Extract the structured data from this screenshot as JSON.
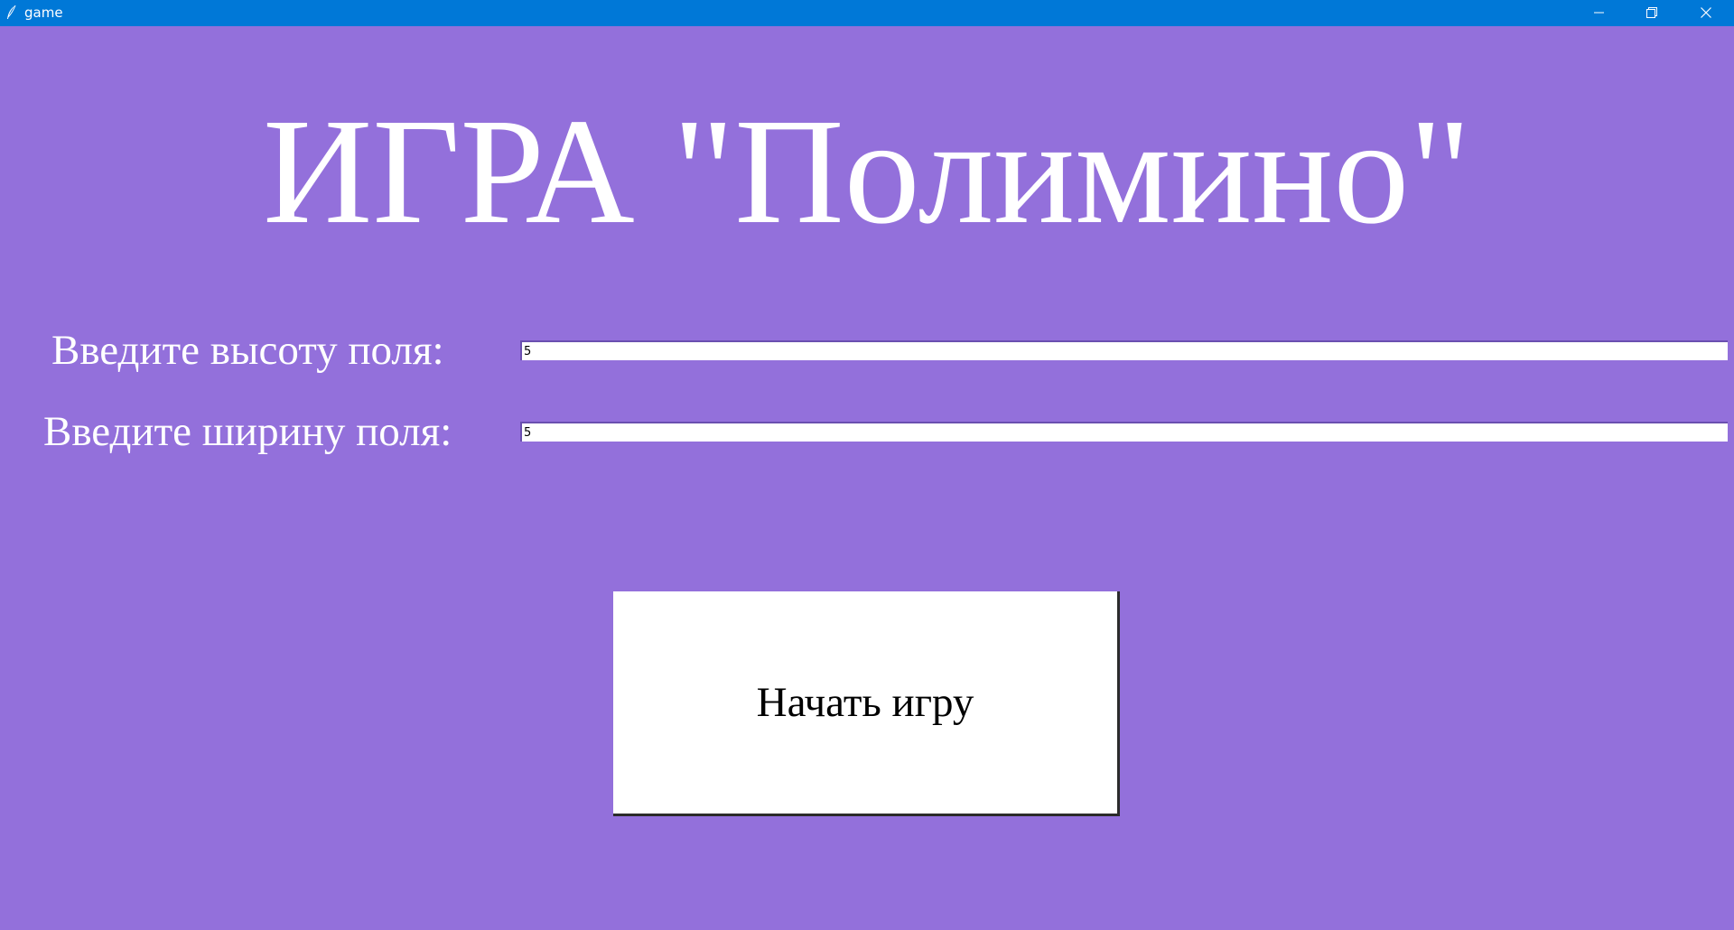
{
  "window": {
    "title": "game",
    "controls": {
      "minimize_icon": "minimize-icon",
      "maximize_icon": "restore-icon",
      "close_icon": "close-icon"
    },
    "colors": {
      "titlebar": "#0078D7",
      "background": "#9370DB"
    }
  },
  "main": {
    "heading": "ИГРА \"Полимино\"",
    "height_label": "Введите высоту поля:",
    "height_value": "5",
    "width_label": "Введите ширину поля:",
    "width_value": "5",
    "start_button_label": "Начать игру"
  }
}
